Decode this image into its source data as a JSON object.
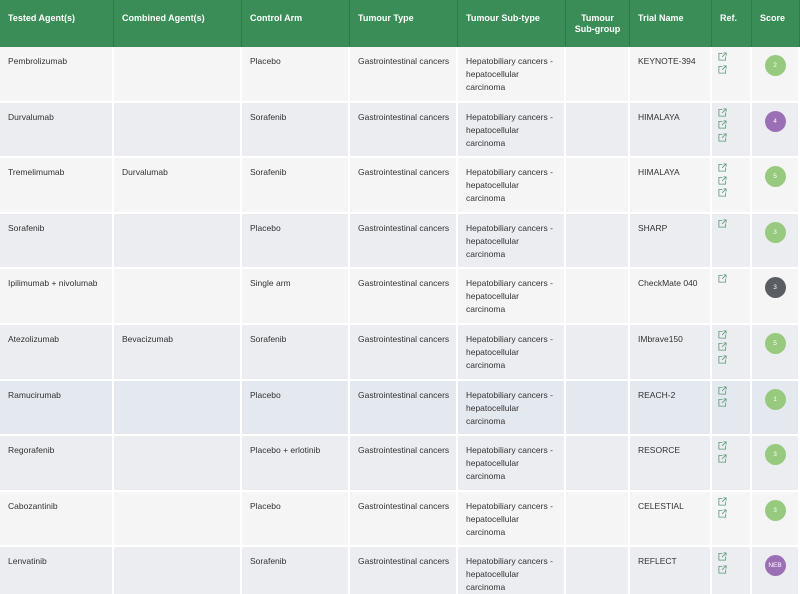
{
  "header": {
    "tested_agents": "Tested Agent(s)",
    "combined_agents": "Combined Agent(s)",
    "control_arm": "Control Arm",
    "tumour_type": "Tumour Type",
    "tumour_subtype": "Tumour Sub-type",
    "tumour_subgroup_line1": "Tumour",
    "tumour_subgroup_line2": "Sub-group",
    "trial_name": "Trial Name",
    "ref": "Ref.",
    "score": "Score"
  },
  "colors": {
    "header_bg": "#3a8d57",
    "link_icon": "#5a9a78",
    "score_green": "#97c97e",
    "score_purple": "#9b6fb5",
    "score_gray": "#5a5e63"
  },
  "rows": [
    {
      "tested": "Pembrolizumab",
      "combined": "",
      "control": "Placebo",
      "type": "Gastrointestinal cancers",
      "subtype_line1": "Hepatobiliary cancers -",
      "subtype_line2": "hepatocellular carcinoma",
      "subgroup": "",
      "trial": "KEYNOTE-394",
      "refs": 2,
      "score": "2",
      "score_color": "green"
    },
    {
      "tested": "Durvalumab",
      "combined": "",
      "control": "Sorafenib",
      "type": "Gastrointestinal cancers",
      "subtype_line1": "Hepatobiliary cancers -",
      "subtype_line2": "hepatocellular carcinoma",
      "subgroup": "",
      "trial": "HIMALAYA",
      "refs": 3,
      "score": "4",
      "score_color": "purple"
    },
    {
      "tested": "Tremelimumab",
      "combined": "Durvalumab",
      "control": "Sorafenib",
      "type": "Gastrointestinal cancers",
      "subtype_line1": "Hepatobiliary cancers -",
      "subtype_line2": "hepatocellular carcinoma",
      "subgroup": "",
      "trial": "HIMALAYA",
      "refs": 3,
      "score": "5",
      "score_color": "green"
    },
    {
      "tested": "Sorafenib",
      "combined": "",
      "control": "Placebo",
      "type": "Gastrointestinal cancers",
      "subtype_line1": "Hepatobiliary cancers -",
      "subtype_line2": "hepatocellular carcinoma",
      "subgroup": "",
      "trial": "SHARP",
      "refs": 1,
      "score": "3",
      "score_color": "green"
    },
    {
      "tested": "Ipilimumab + nivolumab",
      "combined": "",
      "control": "Single arm",
      "type": "Gastrointestinal cancers",
      "subtype_line1": "Hepatobiliary cancers -",
      "subtype_line2": "hepatocellular carcinoma",
      "subgroup": "",
      "trial": "CheckMate 040",
      "refs": 1,
      "score": "3",
      "score_color": "gray"
    },
    {
      "tested": "Atezolizumab",
      "combined": "Bevacizumab",
      "control": "Sorafenib",
      "type": "Gastrointestinal cancers",
      "subtype_line1": "Hepatobiliary cancers -",
      "subtype_line2": "hepatocellular carcinoma",
      "subgroup": "",
      "trial": "IMbrave150",
      "refs": 3,
      "score": "5",
      "score_color": "green"
    },
    {
      "tested": "Ramucirumab",
      "combined": "",
      "control": "Placebo",
      "type": "Gastrointestinal cancers",
      "subtype_line1": "Hepatobiliary cancers -",
      "subtype_line2": "hepatocellular carcinoma",
      "subgroup": "",
      "trial": "REACH-2",
      "refs": 2,
      "score": "1",
      "score_color": "green"
    },
    {
      "tested": "Regorafenib",
      "combined": "",
      "control": "Placebo + erlotinib",
      "type": "Gastrointestinal cancers",
      "subtype_line1": "Hepatobiliary cancers -",
      "subtype_line2": "hepatocellular carcinoma",
      "subgroup": "",
      "trial": "RESORCE",
      "refs": 2,
      "score": "3",
      "score_color": "green"
    },
    {
      "tested": "Cabozantinib",
      "combined": "",
      "control": "Placebo",
      "type": "Gastrointestinal cancers",
      "subtype_line1": "Hepatobiliary cancers -",
      "subtype_line2": "hepatocellular carcinoma",
      "subgroup": "",
      "trial": "CELESTIAL",
      "refs": 2,
      "score": "3",
      "score_color": "green"
    },
    {
      "tested": "Lenvatinib",
      "combined": "",
      "control": "Sorafenib",
      "type": "Gastrointestinal cancers",
      "subtype_line1": "Hepatobiliary cancers -",
      "subtype_line2": "hepatocellular carcinoma",
      "subgroup": "",
      "trial": "REFLECT",
      "refs": 2,
      "score": "NEB",
      "score_color": "purple"
    }
  ]
}
